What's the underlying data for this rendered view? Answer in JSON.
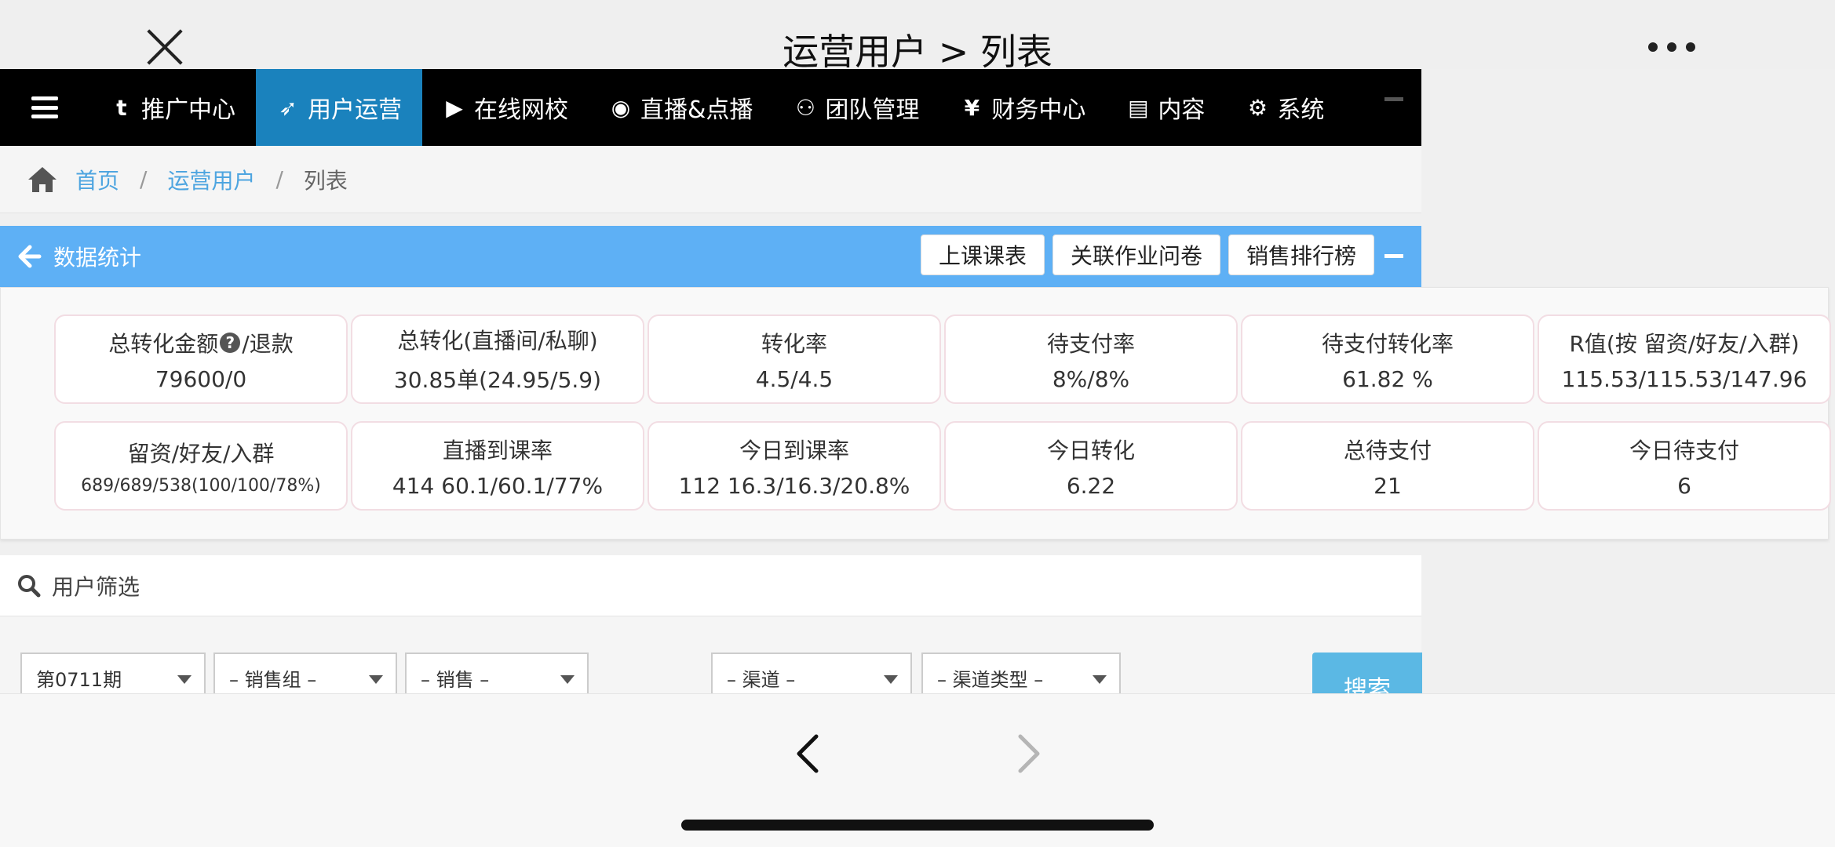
{
  "window": {
    "title": "运营用户 > 列表"
  },
  "nav": {
    "items": [
      {
        "label": "推广中心",
        "icon": "t"
      },
      {
        "label": "用户运营",
        "icon": "➶",
        "active": true
      },
      {
        "label": "在线网校",
        "icon": "▶"
      },
      {
        "label": "直播&点播",
        "icon": "◉"
      },
      {
        "label": "团队管理",
        "icon": "⚇"
      },
      {
        "label": "财务中心",
        "icon": "¥"
      },
      {
        "label": "内容",
        "icon": "▤"
      },
      {
        "label": "系统",
        "icon": "⚙"
      }
    ]
  },
  "breadcrumb": {
    "home": "首页",
    "section": "运营用户",
    "current": "列表",
    "sep": "/"
  },
  "stats": {
    "title": "数据统计",
    "buttons": {
      "schedule": "上课课表",
      "homework": "关联作业问卷",
      "ranking": "销售排行榜"
    },
    "cards": [
      {
        "label": "总转化金额",
        "label_suffix": "/退款",
        "value": "79600/0",
        "help": "?"
      },
      {
        "label": "总转化(直播间/私聊)",
        "value": "30.85单(24.95/5.9)"
      },
      {
        "label": "转化率",
        "value": "4.5/4.5"
      },
      {
        "label": "待支付率",
        "value": "8%/8%"
      },
      {
        "label": "待支付转化率",
        "value": "61.82 %"
      },
      {
        "label": "R值(按 留资/好友/入群)",
        "value": "115.53/115.53/147.96"
      },
      {
        "label": "留资/好友/入群",
        "value": "689/689/538(100/100/78%)"
      },
      {
        "label": "直播到课率",
        "value": "414  60.1/60.1/77%"
      },
      {
        "label": "今日到课率",
        "value": "112  16.3/16.3/20.8%"
      },
      {
        "label": "今日转化",
        "value": "6.22"
      },
      {
        "label": "总待支付",
        "value": "21"
      },
      {
        "label": "今日待支付",
        "value": "6"
      }
    ]
  },
  "filter": {
    "title": "用户筛选",
    "period": "第0711期",
    "sales_group": "– 销售组 –",
    "sales": "– 销售 –",
    "channel": "– 渠道 –",
    "channel_type": "– 渠道类型 –",
    "search_label": "搜索"
  }
}
